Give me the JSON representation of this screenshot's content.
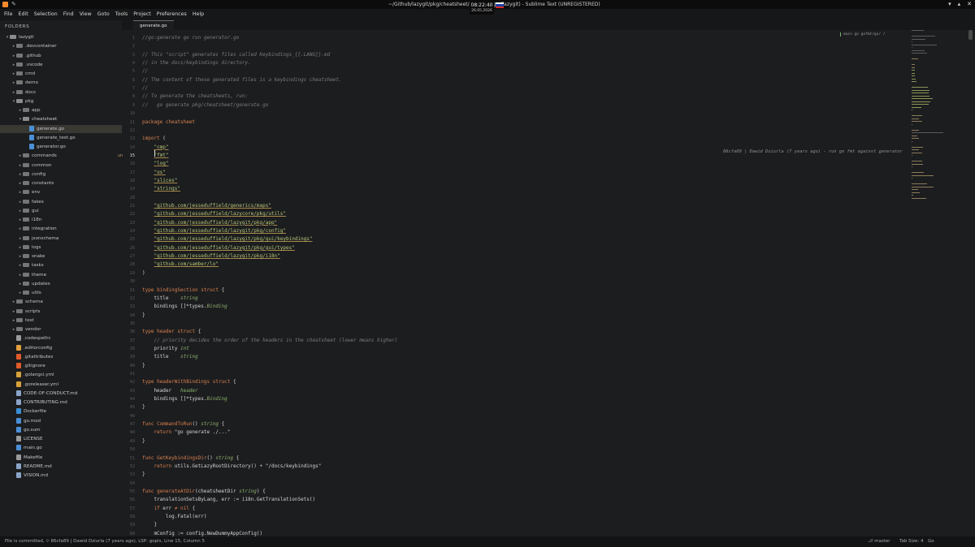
{
  "window": {
    "title": "~/Github/lazygit/pkg/cheatsheet/generate.go (lazygit) - Sublime Text (UNREGISTERED)",
    "clock_time": "08:22:40",
    "clock_date": "26.05.2026"
  },
  "menu": [
    "File",
    "Edit",
    "Selection",
    "Find",
    "View",
    "Goto",
    "Tools",
    "Project",
    "Preferences",
    "Help"
  ],
  "sidebar": {
    "header": "FOLDERS",
    "items": [
      {
        "label": "lazygit",
        "depth": 0,
        "kind": "folder",
        "open": true
      },
      {
        "label": ".devcontainer",
        "depth": 1,
        "kind": "folder"
      },
      {
        "label": ".github",
        "depth": 1,
        "kind": "folder"
      },
      {
        "label": ".vscode",
        "depth": 1,
        "kind": "folder"
      },
      {
        "label": "cmd",
        "depth": 1,
        "kind": "folder"
      },
      {
        "label": "demo",
        "depth": 1,
        "kind": "folder"
      },
      {
        "label": "docs",
        "depth": 1,
        "kind": "folder"
      },
      {
        "label": "pkg",
        "depth": 1,
        "kind": "folder",
        "open": true
      },
      {
        "label": "app",
        "depth": 2,
        "kind": "folder"
      },
      {
        "label": "cheatsheet",
        "depth": 2,
        "kind": "folder",
        "open": true
      },
      {
        "label": "generate.go",
        "depth": 3,
        "kind": "file",
        "icon": "#4a8fd6",
        "selected": true
      },
      {
        "label": "generate_test.go",
        "depth": 3,
        "kind": "file",
        "icon": "#4a8fd6"
      },
      {
        "label": "generator.go",
        "depth": 3,
        "kind": "file",
        "icon": "#4a8fd6"
      },
      {
        "label": "commands",
        "depth": 2,
        "kind": "folder"
      },
      {
        "label": "common",
        "depth": 2,
        "kind": "folder"
      },
      {
        "label": "config",
        "depth": 2,
        "kind": "folder"
      },
      {
        "label": "constants",
        "depth": 2,
        "kind": "folder"
      },
      {
        "label": "env",
        "depth": 2,
        "kind": "folder"
      },
      {
        "label": "fakes",
        "depth": 2,
        "kind": "folder"
      },
      {
        "label": "gui",
        "depth": 2,
        "kind": "folder"
      },
      {
        "label": "i18n",
        "depth": 2,
        "kind": "folder"
      },
      {
        "label": "integration",
        "depth": 2,
        "kind": "folder"
      },
      {
        "label": "jsonschema",
        "depth": 2,
        "kind": "folder"
      },
      {
        "label": "logs",
        "depth": 2,
        "kind": "folder"
      },
      {
        "label": "snake",
        "depth": 2,
        "kind": "folder"
      },
      {
        "label": "tasks",
        "depth": 2,
        "kind": "folder"
      },
      {
        "label": "theme",
        "depth": 2,
        "kind": "folder"
      },
      {
        "label": "updates",
        "depth": 2,
        "kind": "folder"
      },
      {
        "label": "utils",
        "depth": 2,
        "kind": "folder"
      },
      {
        "label": "schema",
        "depth": 1,
        "kind": "folder"
      },
      {
        "label": "scripts",
        "depth": 1,
        "kind": "folder"
      },
      {
        "label": "test",
        "depth": 1,
        "kind": "folder"
      },
      {
        "label": "vendor",
        "depth": 1,
        "kind": "folder"
      },
      {
        "label": ".codespellrc",
        "depth": 1,
        "kind": "file",
        "icon": "#9a9a9a"
      },
      {
        "label": ".editorconfig",
        "depth": 1,
        "kind": "file",
        "icon": "#e0a040"
      },
      {
        "label": ".gitattributes",
        "depth": 1,
        "kind": "file",
        "icon": "#e05a2b"
      },
      {
        "label": ".gitignore",
        "depth": 1,
        "kind": "file",
        "icon": "#e05a2b"
      },
      {
        "label": ".golangci.yml",
        "depth": 1,
        "kind": "file",
        "icon": "#d6a23a"
      },
      {
        "label": ".goreleaser.yml",
        "depth": 1,
        "kind": "file",
        "icon": "#d6a23a"
      },
      {
        "label": "CODE-OF-CONDUCT.md",
        "depth": 1,
        "kind": "file",
        "icon": "#8aa4c8"
      },
      {
        "label": "CONTRIBUTING.md",
        "depth": 1,
        "kind": "file",
        "icon": "#8aa4c8"
      },
      {
        "label": "Dockerfile",
        "depth": 1,
        "kind": "file",
        "icon": "#3a8fd6"
      },
      {
        "label": "go.mod",
        "depth": 1,
        "kind": "file",
        "icon": "#4a8fd6"
      },
      {
        "label": "go.sum",
        "depth": 1,
        "kind": "file",
        "icon": "#4a8fd6"
      },
      {
        "label": "LICENSE",
        "depth": 1,
        "kind": "file",
        "icon": "#9a9a9a"
      },
      {
        "label": "main.go",
        "depth": 1,
        "kind": "file",
        "icon": "#4a8fd6"
      },
      {
        "label": "Makefile",
        "depth": 1,
        "kind": "file",
        "icon": "#9a9a9a"
      },
      {
        "label": "README.md",
        "depth": 1,
        "kind": "file",
        "icon": "#8aa4c8"
      },
      {
        "label": "VISION.md",
        "depth": 1,
        "kind": "file",
        "icon": "#8aa4c8"
      }
    ]
  },
  "tab": {
    "label": "generate.go"
  },
  "editor": {
    "current_line": 15,
    "gutter_mark": "un",
    "blame": "86cfa89 | Dawid Dziurla (7 years ago) - run go fmt against generator",
    "breadcrumb": "main     go     gofmt/go/     /",
    "lines": [
      {
        "n": 1,
        "html": "<span class='cm'>//go:generate go run generator.go</span>"
      },
      {
        "n": 2,
        "html": ""
      },
      {
        "n": 3,
        "html": "<span class='cm'>// This \"script\" generates files called Keybindings_{{.LANG}}.md</span>"
      },
      {
        "n": 4,
        "html": "<span class='cm'>// in the docs/keybindings directory.</span>"
      },
      {
        "n": 5,
        "html": "<span class='cm'>//</span>"
      },
      {
        "n": 6,
        "html": "<span class='cm'>// The content of these generated files is a keybindings cheatsheet.</span>"
      },
      {
        "n": 7,
        "html": "<span class='cm'>//</span>"
      },
      {
        "n": 8,
        "html": "<span class='cm'>// To generate the cheatsheets, run:</span>"
      },
      {
        "n": 9,
        "html": "<span class='cm'>//   go generate pkg/cheatsheet/generate.go</span>"
      },
      {
        "n": 10,
        "html": ""
      },
      {
        "n": 11,
        "html": "<span class='kw'>package</span> <span class='kw'>cheatsheet</span>"
      },
      {
        "n": 12,
        "html": ""
      },
      {
        "n": 13,
        "html": "<span class='kw'>import</span> ("
      },
      {
        "n": 14,
        "html": "    <span class='str'>\"cmp\"</span>"
      },
      {
        "n": 15,
        "html": "    <span class='str'>\"fmt\"</span>"
      },
      {
        "n": 16,
        "html": "    <span class='str'>\"log\"</span>"
      },
      {
        "n": 17,
        "html": "    <span class='str'>\"os\"</span>"
      },
      {
        "n": 18,
        "html": "    <span class='str'>\"slices\"</span>"
      },
      {
        "n": 19,
        "html": "    <span class='str'>\"strings\"</span>"
      },
      {
        "n": 20,
        "html": ""
      },
      {
        "n": 21,
        "html": "    <span class='str'>\"github.com/jesseduffield/generics/maps\"</span>"
      },
      {
        "n": 22,
        "html": "    <span class='str'>\"github.com/jesseduffield/lazycore/pkg/utils\"</span>"
      },
      {
        "n": 23,
        "html": "    <span class='str'>\"github.com/jesseduffield/lazygit/pkg/app\"</span>"
      },
      {
        "n": 24,
        "html": "    <span class='str'>\"github.com/jesseduffield/lazygit/pkg/config\"</span>"
      },
      {
        "n": 25,
        "html": "    <span class='str'>\"github.com/jesseduffield/lazygit/pkg/gui/keybindings\"</span>"
      },
      {
        "n": 26,
        "html": "    <span class='str'>\"github.com/jesseduffield/lazygit/pkg/gui/types\"</span>"
      },
      {
        "n": 27,
        "html": "    <span class='str'>\"github.com/jesseduffield/lazygit/pkg/i18n\"</span>"
      },
      {
        "n": 28,
        "html": "    <span class='str'>\"github.com/samber/lo\"</span>"
      },
      {
        "n": 29,
        "html": ")"
      },
      {
        "n": 30,
        "html": ""
      },
      {
        "n": 31,
        "html": "<span class='kw'>type</span> <span class='kw'>bindingSection</span> <span class='kw'>struct</span> {"
      },
      {
        "n": 32,
        "html": "    title    <span class='ty'>string</span>"
      },
      {
        "n": 33,
        "html": "    bindings []*types.<span class='ty'>Binding</span>"
      },
      {
        "n": 34,
        "html": "}"
      },
      {
        "n": 35,
        "html": ""
      },
      {
        "n": 36,
        "html": "<span class='kw'>type</span> <span class='kw'>header</span> <span class='kw'>struct</span> {"
      },
      {
        "n": 37,
        "html": "    <span class='cm'>// priority decides the order of the headers in the cheatsheet (lower means higher)</span>"
      },
      {
        "n": 38,
        "html": "    priority <span class='ty'>int</span>"
      },
      {
        "n": 39,
        "html": "    title    <span class='ty'>string</span>"
      },
      {
        "n": 40,
        "html": "}"
      },
      {
        "n": 41,
        "html": ""
      },
      {
        "n": 42,
        "html": "<span class='kw'>type</span> <span class='kw'>headerWithBindings</span> <span class='kw'>struct</span> {"
      },
      {
        "n": 43,
        "html": "    header   <span class='ty'>header</span>"
      },
      {
        "n": 44,
        "html": "    bindings []*types.<span class='ty'>Binding</span>"
      },
      {
        "n": 45,
        "html": "}"
      },
      {
        "n": 46,
        "html": ""
      },
      {
        "n": 47,
        "html": "<span class='kw'>func</span> <span class='kw'>CommandToRun</span>() <span class='ty'>string</span> {"
      },
      {
        "n": 48,
        "html": "    <span class='kw'>return</span> \"go generate ./...\""
      },
      {
        "n": 49,
        "html": "}"
      },
      {
        "n": 50,
        "html": ""
      },
      {
        "n": 51,
        "html": "<span class='kw'>func</span> <span class='kw'>GetKeybindingsDir</span>() <span class='ty'>string</span> {"
      },
      {
        "n": 52,
        "html": "    <span class='kw'>return</span> utils.GetLazyRootDirectory() + \"/docs/keybindings\""
      },
      {
        "n": 53,
        "html": "}"
      },
      {
        "n": 54,
        "html": ""
      },
      {
        "n": 55,
        "html": "<span class='kw'>func</span> <span class='kw'>generateAtDir</span>(cheatsheetDir <span class='ty'>string</span>) {"
      },
      {
        "n": 56,
        "html": "    translationSetsByLang, err := i18n.GetTranslationSets()"
      },
      {
        "n": 57,
        "html": "    <span class='kw'>if</span> err <span class='kw'>≠</span> <span class='kw'>nil</span> {"
      },
      {
        "n": 58,
        "html": "        log.Fatal(err)"
      },
      {
        "n": 59,
        "html": "    }"
      },
      {
        "n": 60,
        "html": "    mConfig := config.NewDummyAppConfig()"
      }
    ]
  },
  "status": {
    "left": "File is committed, ⟐ 86cfa89 | Dawid Dziurla (7 years ago), LSP: gopls, Line 15, Column 5",
    "branch": "⎇ master",
    "tab_size": "Tab Size: 4",
    "syntax": "Go"
  }
}
